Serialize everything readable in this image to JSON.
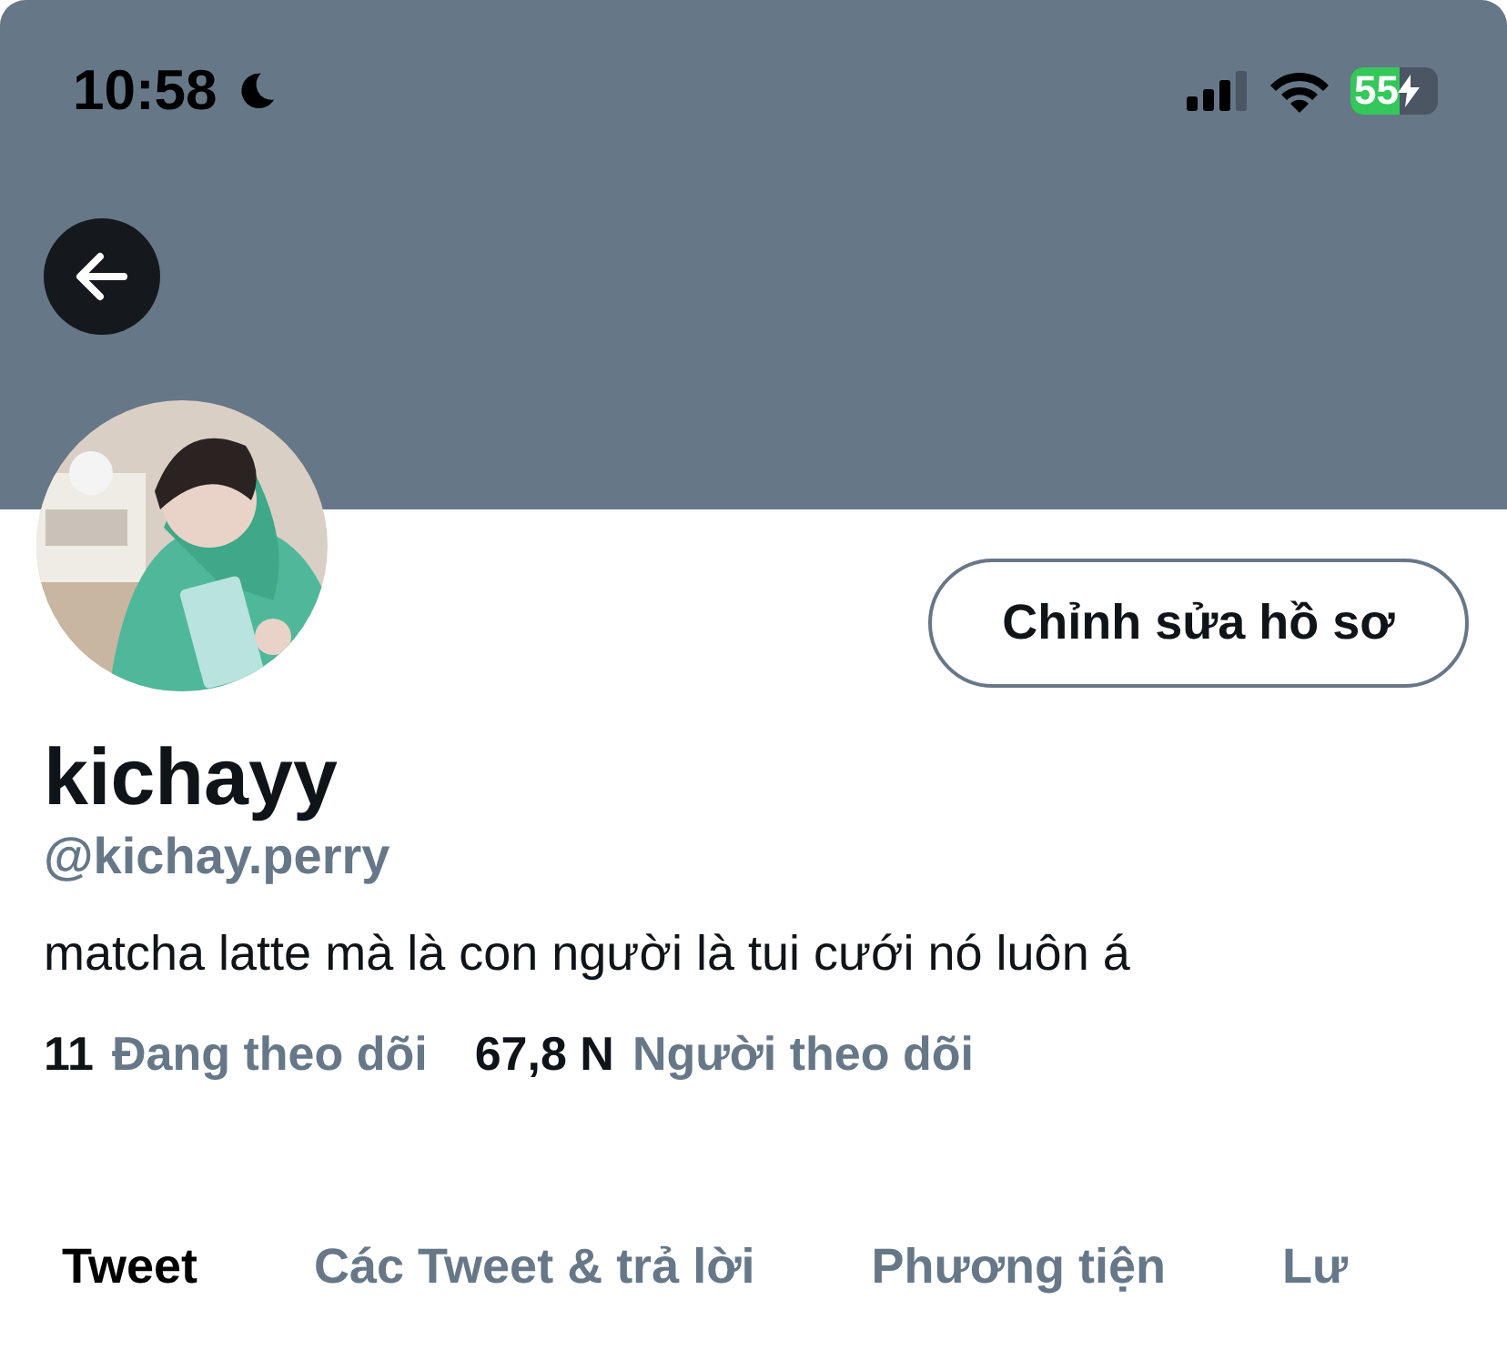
{
  "status_bar": {
    "time": "10:58",
    "battery": "55"
  },
  "profile": {
    "name": "kichayy",
    "handle": "@kichay.perry",
    "bio": "matcha latte mà là con người là tui cưới nó luôn á",
    "edit_button": "Chỉnh sửa hồ sơ"
  },
  "stats": [
    {
      "count": "11",
      "label": "Đang theo dõi"
    },
    {
      "count": "67,8 N",
      "label": "Người theo dõi"
    }
  ],
  "tabs": [
    {
      "label": "Tweet",
      "selected": true
    },
    {
      "label": "Các Tweet & trả lời",
      "selected": false
    },
    {
      "label": "Phương tiện",
      "selected": false
    },
    {
      "label": "Lư",
      "selected": false
    }
  ]
}
